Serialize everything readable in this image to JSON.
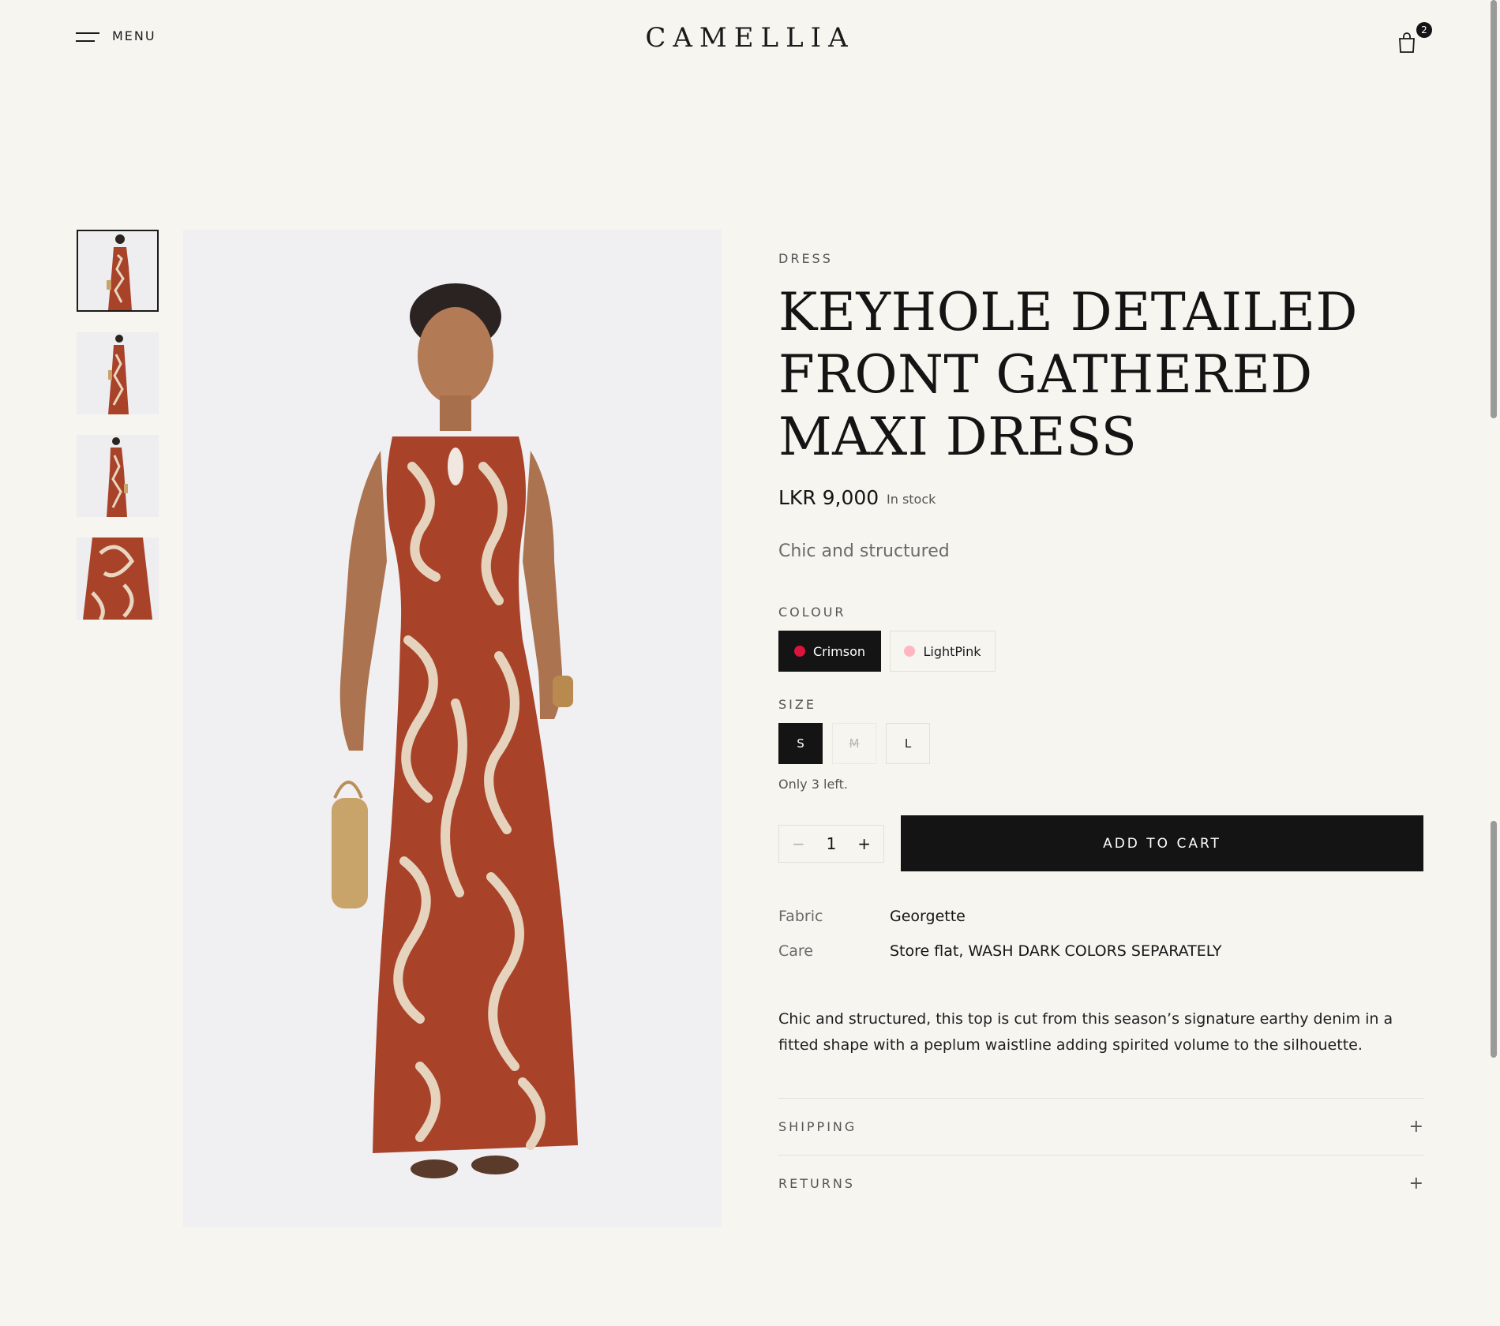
{
  "header": {
    "menu_label": "MENU",
    "logo": "CAMELLIA",
    "cart_count": "2"
  },
  "product": {
    "category": "DRESS",
    "title": "KEYHOLE DETAILED FRONT GATHERED MAXI DRESS",
    "price": "LKR 9,000",
    "stock": "In stock",
    "tagline": "Chic and structured",
    "colour_label": "COLOUR",
    "colours": [
      {
        "name": "Crimson",
        "color": "#dc143c",
        "selected": true
      },
      {
        "name": "LightPink",
        "color": "#ffb6c1",
        "selected": false
      }
    ],
    "size_label": "SIZE",
    "sizes": [
      {
        "name": "S",
        "state": "selected"
      },
      {
        "name": "M",
        "state": "unavailable"
      },
      {
        "name": "L",
        "state": "available"
      }
    ],
    "stock_note": "Only 3 left.",
    "quantity": "1",
    "qty_minus": "−",
    "qty_plus": "+",
    "add_to_cart": "ADD TO CART",
    "specs": [
      {
        "key": "Fabric",
        "value": "Georgette"
      },
      {
        "key": "Care",
        "value": "Store flat, WASH DARK COLORS SEPARATELY"
      }
    ],
    "description": "Chic and structured, this top is cut from this season’s signature earthy denim in a fitted shape with a peplum waistline adding spirited volume to the silhouette.",
    "accordions": [
      {
        "label": "SHIPPING",
        "icon": "+"
      },
      {
        "label": "RETURNS",
        "icon": "+"
      }
    ]
  },
  "colors": {
    "background": "#f7f5f0",
    "primary": "#141414",
    "dress": "#a8432a"
  }
}
